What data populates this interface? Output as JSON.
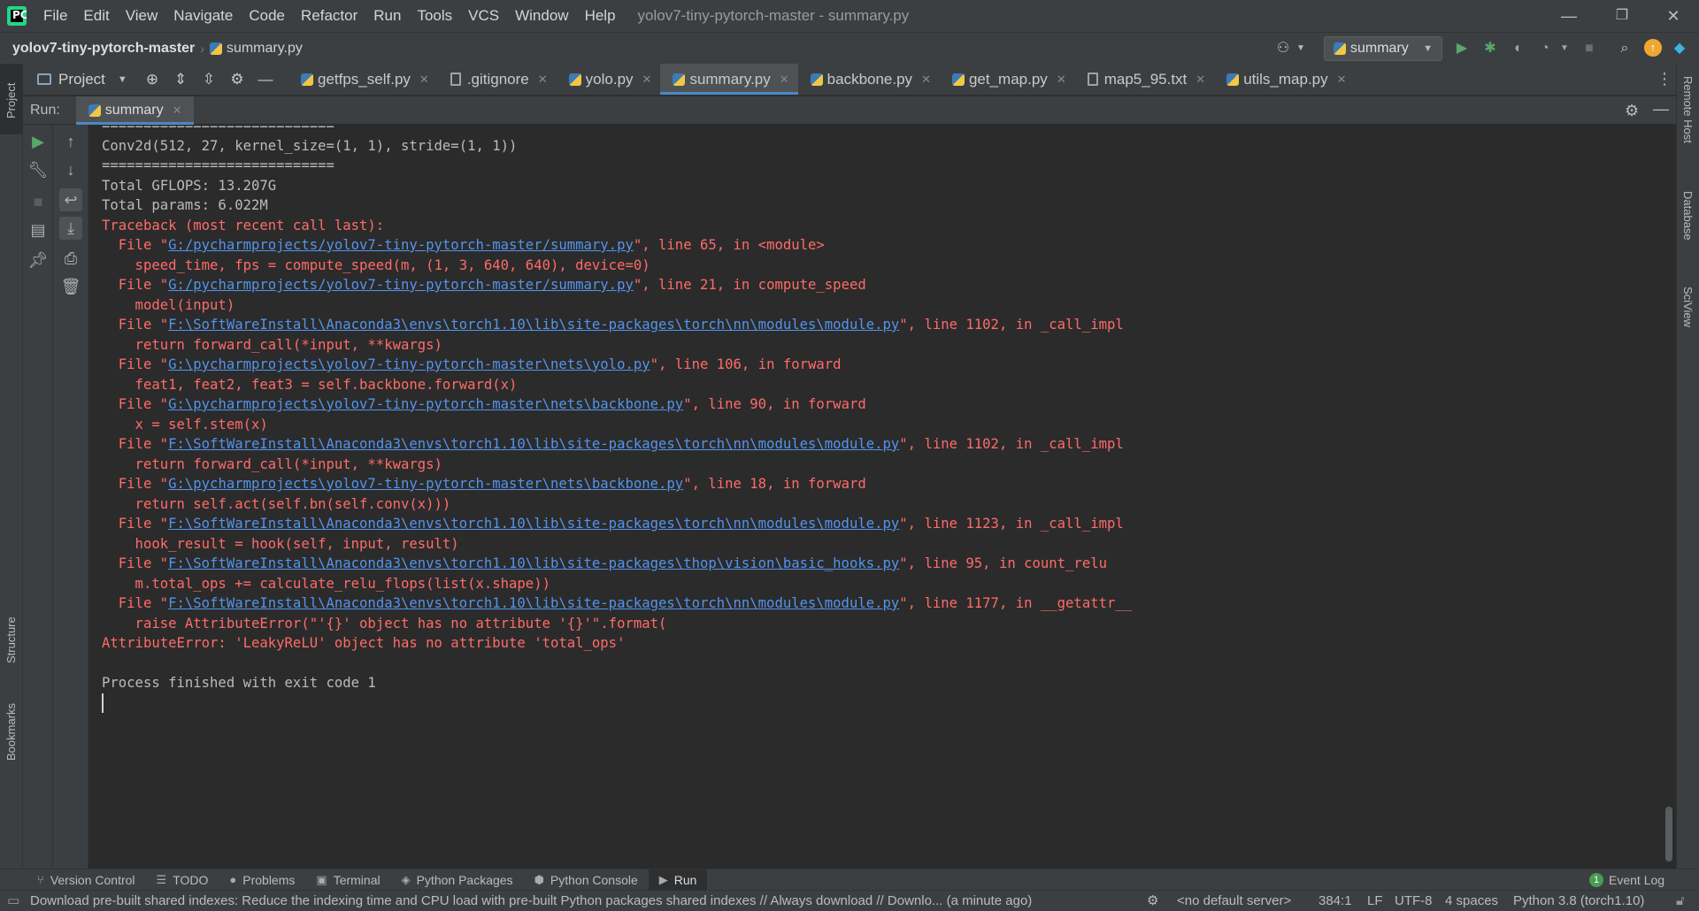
{
  "window": {
    "title": "yolov7-tiny-pytorch-master - summary.py",
    "minimize": "—",
    "restore": "❐",
    "close": "✕"
  },
  "menu": [
    "File",
    "Edit",
    "View",
    "Navigate",
    "Code",
    "Refactor",
    "Run",
    "Tools",
    "VCS",
    "Window",
    "Help"
  ],
  "navbar": {
    "project": "yolov7-tiny-pytorch-master",
    "separator": "›",
    "file": "summary.py",
    "run_config": "summary"
  },
  "project_tool": {
    "label": "Project"
  },
  "tabs": [
    {
      "label": "getfps_self.py",
      "icon": "python-file-icon"
    },
    {
      "label": ".gitignore",
      "icon": "text-file-icon"
    },
    {
      "label": "yolo.py",
      "icon": "python-file-icon"
    },
    {
      "label": "summary.py",
      "icon": "python-file-icon",
      "active": true
    },
    {
      "label": "backbone.py",
      "icon": "python-file-icon"
    },
    {
      "label": "get_map.py",
      "icon": "python-file-icon"
    },
    {
      "label": "map5_95.txt",
      "icon": "text-file-icon"
    },
    {
      "label": "utils_map.py",
      "icon": "python-file-icon"
    }
  ],
  "run_panel": {
    "label": "Run:",
    "tab": "summary"
  },
  "left_stripe": {
    "project": "Project",
    "structure": "Structure",
    "bookmarks": "Bookmarks"
  },
  "right_stripe": {
    "remote_host": "Remote Host",
    "database": "Database",
    "sciview": "SciView"
  },
  "console": {
    "lines": [
      {
        "type": "out",
        "text": "============================"
      },
      {
        "type": "out",
        "text": "Conv2d(512, 27, kernel_size=(1, 1), stride=(1, 1))"
      },
      {
        "type": "out",
        "text": "============================"
      },
      {
        "type": "out",
        "text": "Total GFLOPS: 13.207G"
      },
      {
        "type": "out",
        "text": "Total params: 6.022M"
      },
      {
        "type": "err",
        "text": "Traceback (most recent call last):"
      },
      {
        "type": "file",
        "pre": "  File \"",
        "link": "G:/pycharmprojects/yolov7-tiny-pytorch-master/summary.py",
        "post": "\", line 65, in <module>"
      },
      {
        "type": "err",
        "text": "    speed_time, fps = compute_speed(m, (1, 3, 640, 640), device=0)"
      },
      {
        "type": "file",
        "pre": "  File \"",
        "link": "G:/pycharmprojects/yolov7-tiny-pytorch-master/summary.py",
        "post": "\", line 21, in compute_speed"
      },
      {
        "type": "err",
        "text": "    model(input)"
      },
      {
        "type": "file",
        "pre": "  File \"",
        "link": "F:\\SoftWareInstall\\Anaconda3\\envs\\torch1.10\\lib\\site-packages\\torch\\nn\\modules\\module.py",
        "post": "\", line 1102, in _call_impl"
      },
      {
        "type": "err",
        "text": "    return forward_call(*input, **kwargs)"
      },
      {
        "type": "file",
        "pre": "  File \"",
        "link": "G:\\pycharmprojects\\yolov7-tiny-pytorch-master\\nets\\yolo.py",
        "post": "\", line 106, in forward"
      },
      {
        "type": "err",
        "text": "    feat1, feat2, feat3 = self.backbone.forward(x)"
      },
      {
        "type": "file",
        "pre": "  File \"",
        "link": "G:\\pycharmprojects\\yolov7-tiny-pytorch-master\\nets\\backbone.py",
        "post": "\", line 90, in forward"
      },
      {
        "type": "err",
        "text": "    x = self.stem(x)"
      },
      {
        "type": "file",
        "pre": "  File \"",
        "link": "F:\\SoftWareInstall\\Anaconda3\\envs\\torch1.10\\lib\\site-packages\\torch\\nn\\modules\\module.py",
        "post": "\", line 1102, in _call_impl"
      },
      {
        "type": "err",
        "text": "    return forward_call(*input, **kwargs)"
      },
      {
        "type": "file",
        "pre": "  File \"",
        "link": "G:\\pycharmprojects\\yolov7-tiny-pytorch-master\\nets\\backbone.py",
        "post": "\", line 18, in forward"
      },
      {
        "type": "err",
        "text": "    return self.act(self.bn(self.conv(x)))"
      },
      {
        "type": "file",
        "pre": "  File \"",
        "link": "F:\\SoftWareInstall\\Anaconda3\\envs\\torch1.10\\lib\\site-packages\\torch\\nn\\modules\\module.py",
        "post": "\", line 1123, in _call_impl"
      },
      {
        "type": "err",
        "text": "    hook_result = hook(self, input, result)"
      },
      {
        "type": "file",
        "pre": "  File \"",
        "link": "F:\\SoftWareInstall\\Anaconda3\\envs\\torch1.10\\lib\\site-packages\\thop\\vision\\basic_hooks.py",
        "post": "\", line 95, in count_relu"
      },
      {
        "type": "err",
        "text": "    m.total_ops += calculate_relu_flops(list(x.shape))"
      },
      {
        "type": "file",
        "pre": "  File \"",
        "link": "F:\\SoftWareInstall\\Anaconda3\\envs\\torch1.10\\lib\\site-packages\\torch\\nn\\modules\\module.py",
        "post": "\", line 1177, in __getattr__"
      },
      {
        "type": "err",
        "text": "    raise AttributeError(\"'{}' object has no attribute '{}'\".format("
      },
      {
        "type": "err",
        "text": "AttributeError: 'LeakyReLU' object has no attribute 'total_ops'"
      },
      {
        "type": "out",
        "text": ""
      },
      {
        "type": "out",
        "text": "Process finished with exit code 1"
      }
    ]
  },
  "bottom_tools": [
    {
      "label": "Version Control",
      "icon": "⑂"
    },
    {
      "label": "TODO",
      "icon": "☰"
    },
    {
      "label": "Problems",
      "icon": "●"
    },
    {
      "label": "Terminal",
      "icon": "▣"
    },
    {
      "label": "Python Packages",
      "icon": "◈"
    },
    {
      "label": "Python Console",
      "icon": "⬢"
    },
    {
      "label": "Run",
      "icon": "▶",
      "active": true
    }
  ],
  "event_log": {
    "label": "Event Log",
    "count": "1"
  },
  "status": {
    "message": "Download pre-built shared indexes: Reduce the indexing time and CPU load with pre-built Python packages shared indexes // Always download // Downlo... (a minute ago)",
    "server": "<no default server>",
    "position": "384:1",
    "line_sep": "LF",
    "encoding": "UTF-8",
    "indent": "4 spaces",
    "interpreter": "Python 3.8 (torch1.10)"
  },
  "colors": {
    "accent": "#4a88c7",
    "error_text": "#ff6b68",
    "link_text": "#5394ec",
    "run_green": "#59a869",
    "update_orange": "#f0a732"
  }
}
